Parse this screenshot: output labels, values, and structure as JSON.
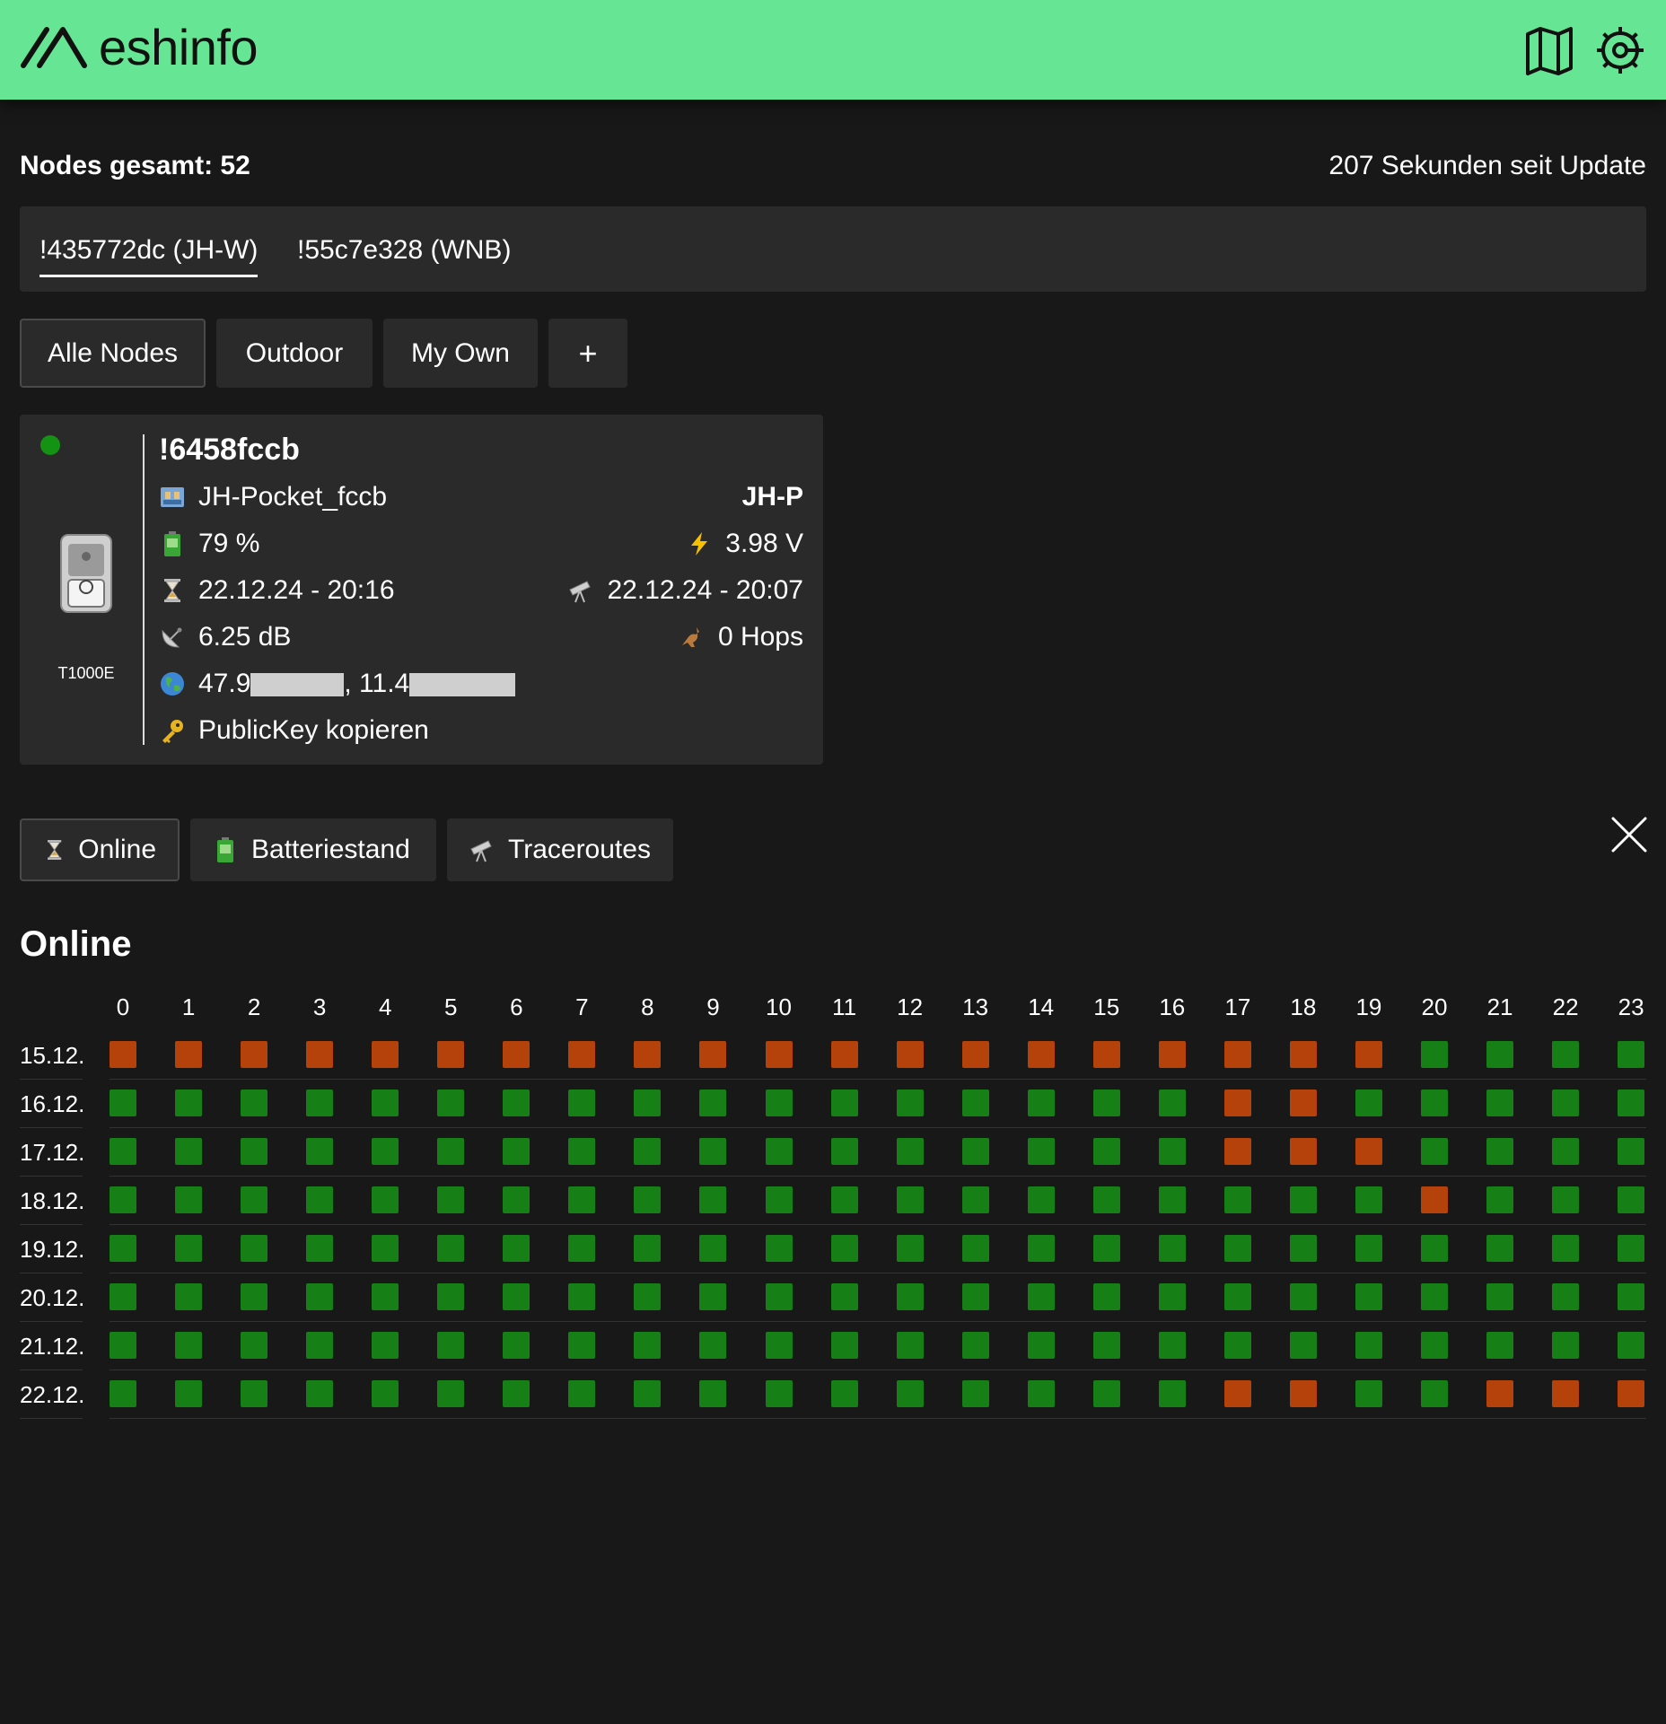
{
  "app": {
    "logo_text": "eshinfo",
    "colors": {
      "header": "#66e694",
      "online": "#167f16",
      "offline": "#b5410b",
      "background": "#181818",
      "panel": "#2a2a2a"
    }
  },
  "summary": {
    "nodes_total": "Nodes gesamt: 52",
    "since_update": "207 Sekunden seit Update"
  },
  "source_tabs": [
    {
      "label": "!435772dc (JH-W)",
      "active": true
    },
    {
      "label": "!55c7e328 (WNB)",
      "active": false
    }
  ],
  "filters": [
    {
      "label": "Alle Nodes",
      "active": true
    },
    {
      "label": "Outdoor",
      "active": false
    },
    {
      "label": "My Own",
      "active": false
    },
    {
      "label": "+",
      "active": false
    }
  ],
  "node": {
    "id": "!6458fccb",
    "device": "T1000E",
    "online": true,
    "long_name": "JH-Pocket_fccb",
    "short_name": "JH-P",
    "battery": "79 %",
    "voltage": "3.98 V",
    "last_heard": "22.12.24 - 20:16",
    "last_traceroute": "22.12.24 - 20:07",
    "snr": "6.25 dB",
    "hops": "0 Hops",
    "lat_prefix": "47.9",
    "lon_prefix": ", 11.4",
    "copy_key": "PublicKey kopieren"
  },
  "detail_tabs": [
    {
      "label": "Online",
      "icon": "hourglass-icon",
      "active": true
    },
    {
      "label": "Batteriestand",
      "icon": "battery-icon",
      "active": false
    },
    {
      "label": "Traceroutes",
      "icon": "telescope-icon",
      "active": false
    }
  ],
  "online_section": {
    "title": "Online",
    "hours": [
      "0",
      "1",
      "2",
      "3",
      "4",
      "5",
      "6",
      "7",
      "8",
      "9",
      "10",
      "11",
      "12",
      "13",
      "14",
      "15",
      "16",
      "17",
      "18",
      "19",
      "20",
      "21",
      "22",
      "23"
    ],
    "days": [
      {
        "date": "15.12.",
        "offline_hours": [
          0,
          1,
          2,
          3,
          4,
          5,
          6,
          7,
          8,
          9,
          10,
          11,
          12,
          13,
          14,
          15,
          16,
          17,
          18,
          19
        ]
      },
      {
        "date": "16.12.",
        "offline_hours": [
          17,
          18
        ]
      },
      {
        "date": "17.12.",
        "offline_hours": [
          17,
          18,
          19
        ]
      },
      {
        "date": "18.12.",
        "offline_hours": [
          20
        ]
      },
      {
        "date": "19.12.",
        "offline_hours": []
      },
      {
        "date": "20.12.",
        "offline_hours": []
      },
      {
        "date": "21.12.",
        "offline_hours": []
      },
      {
        "date": "22.12.",
        "offline_hours": [
          17,
          18,
          21,
          22,
          23
        ]
      }
    ]
  }
}
